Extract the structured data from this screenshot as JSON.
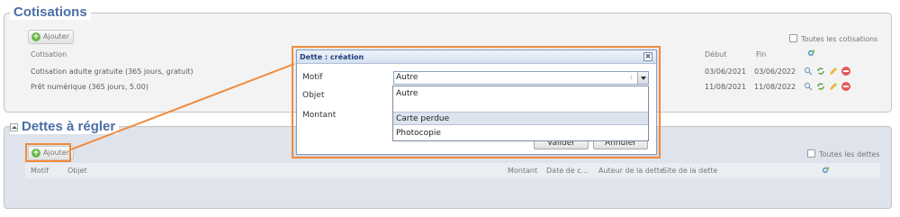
{
  "cotisations": {
    "title": "Cotisations",
    "add_label": "Ajouter",
    "toutes_label": "Toutes les cotisations",
    "headers": {
      "cotisation": "Cotisation",
      "debut": "Début",
      "fin": "Fin"
    },
    "rows": [
      {
        "name": "Cotisation adulte gratuite (365 jours, gratuit)",
        "debut": "03/06/2021",
        "fin": "03/06/2022"
      },
      {
        "name": "Prêt numérique (365 jours, 5.00)",
        "debut": "11/08/2021",
        "fin": "11/08/2022"
      }
    ]
  },
  "dettes": {
    "title": "Dettes à régler",
    "add_label": "Ajouter",
    "toutes_label": "Toutes les dettes",
    "headers": {
      "motif": "Motif",
      "objet": "Objet",
      "montant": "Montant",
      "date": "Date de c...",
      "auteur": "Auteur de la dette",
      "site": "Site de la dette"
    }
  },
  "dialog": {
    "title": "Dette : création",
    "motif_label": "Motif",
    "objet_label": "Objet",
    "montant_label": "Montant",
    "motif_value": "Autre",
    "options": [
      "Autre",
      "",
      "Carte perdue",
      "Photocopie"
    ],
    "valider_label": "Valider",
    "annuler_label": "Annuler"
  },
  "colors": {
    "highlight": "#f08a3c",
    "title_blue": "#4a6fa6"
  }
}
